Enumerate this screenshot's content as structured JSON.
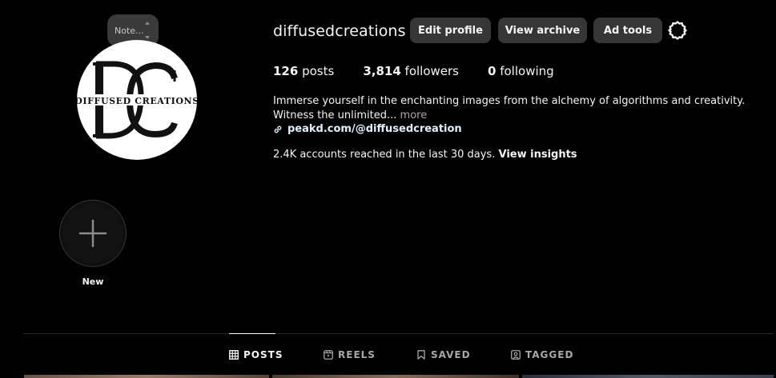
{
  "note": {
    "text": "Note..."
  },
  "profile": {
    "username": "diffusedcreations",
    "avatar_logo_text": "DIFFUSED CREATIONS",
    "avatar_monogram": "DC"
  },
  "buttons": {
    "edit_profile": "Edit profile",
    "view_archive": "View archive",
    "ad_tools": "Ad tools"
  },
  "icons": {
    "settings": "gear-icon",
    "link": "link-icon",
    "add": "plus-icon",
    "posts": "grid-icon",
    "reels": "reels-icon",
    "saved": "bookmark-icon",
    "tagged": "tagged-icon"
  },
  "stats": {
    "posts_count": "126",
    "posts_label": "posts",
    "followers_count": "3,814",
    "followers_label": "followers",
    "following_count": "0",
    "following_label": "following"
  },
  "bio": {
    "text": "Immerse yourself in the enchanting images from the alchemy of algorithms and creativity. Witness the unlimited...",
    "more": "more",
    "link": "peakd.com/@diffusedcreation"
  },
  "insights": {
    "text": "2.4K accounts reached in the last 30 days.",
    "link": "View insights"
  },
  "highlight": {
    "new_label": "New"
  },
  "tabs": [
    {
      "label": "POSTS",
      "active": true
    },
    {
      "label": "REELS",
      "active": false
    },
    {
      "label": "SAVED",
      "active": false
    },
    {
      "label": "TAGGED",
      "active": false
    }
  ],
  "colors": {
    "background": "#000000",
    "button_bg": "#363636",
    "text_primary": "#f5f5f5",
    "text_secondary": "#a8a8a8",
    "link": "#e0f1ff",
    "logo_accent": "#c8102e"
  }
}
